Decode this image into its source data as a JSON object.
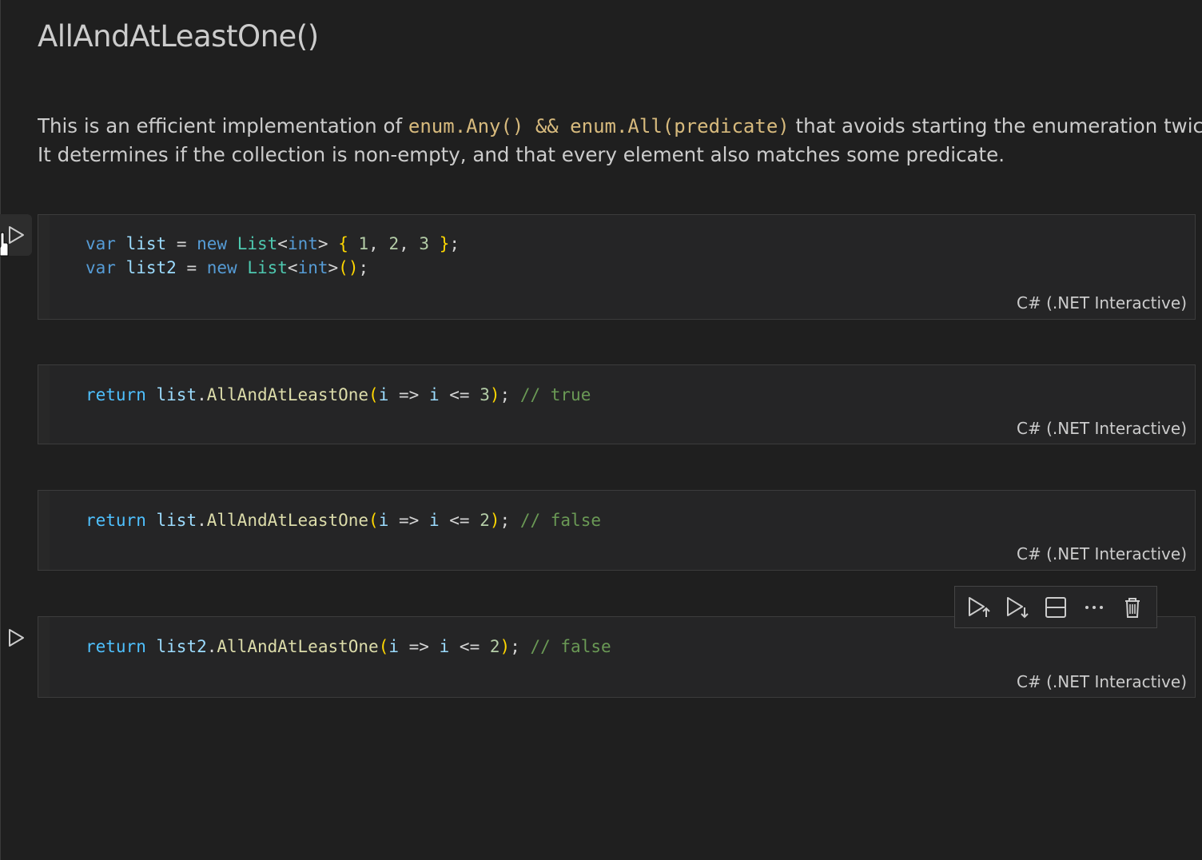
{
  "markdown": {
    "title": "AllAndAtLeastOne()",
    "para_line1_before": "This is an efficient implementation of ",
    "para_line1_code": "enum.Any() && enum.All(predicate)",
    "para_line1_after": " that avoids starting the enumeration twice.",
    "para_line2": "It determines if the collection is non-empty, and that every element also matches some predicate."
  },
  "cells": [
    {
      "language": "C# (.NET Interactive)",
      "lines": [
        {
          "kw1": "var",
          "var": "list",
          "eq": " = ",
          "kw2": "new",
          "type": "List",
          "lt": "<",
          "gen": "int",
          "gt": ">",
          "rest_open": "{",
          "n1": "1",
          "n2": "2",
          "n3": "3",
          "rest_close": "}",
          "semi": ";"
        },
        {
          "kw1": "var",
          "var": "list2",
          "eq": " = ",
          "kw2": "new",
          "type": "List",
          "lt": "<",
          "gen": "int",
          "gt": ">",
          "parens": "()",
          "semi": ";"
        }
      ]
    },
    {
      "language": "C# (.NET Interactive)",
      "kw": "return",
      "target": "list",
      "method": "AllAndAtLeastOne",
      "param": "i",
      "arrow": "=>",
      "cmp_var": "i",
      "cmp": "<=",
      "num": "3",
      "comment": "// true"
    },
    {
      "language": "C# (.NET Interactive)",
      "kw": "return",
      "target": "list",
      "method": "AllAndAtLeastOne",
      "param": "i",
      "arrow": "=>",
      "cmp_var": "i",
      "cmp": "<=",
      "num": "2",
      "comment": "// false"
    },
    {
      "language": "C# (.NET Interactive)",
      "kw": "return",
      "target": "list2",
      "method": "AllAndAtLeastOne",
      "param": "i",
      "arrow": "=>",
      "cmp_var": "i",
      "cmp": "<=",
      "num": "2",
      "comment": "// false"
    }
  ],
  "toolbar": {
    "items": [
      "run-above-icon",
      "run-below-icon",
      "split-cell-icon",
      "more-icon",
      "delete-icon"
    ]
  },
  "colors": {
    "background": "#1f1f1f",
    "cell_background": "#252526",
    "keyword": "#569cd6",
    "variable": "#9cdcfe",
    "type": "#4ec9b0",
    "method": "#dcdcaa",
    "number": "#b5cea8",
    "comment": "#6a9955",
    "bracket": "#ffd700",
    "inline_code": "#d7ba7d"
  }
}
